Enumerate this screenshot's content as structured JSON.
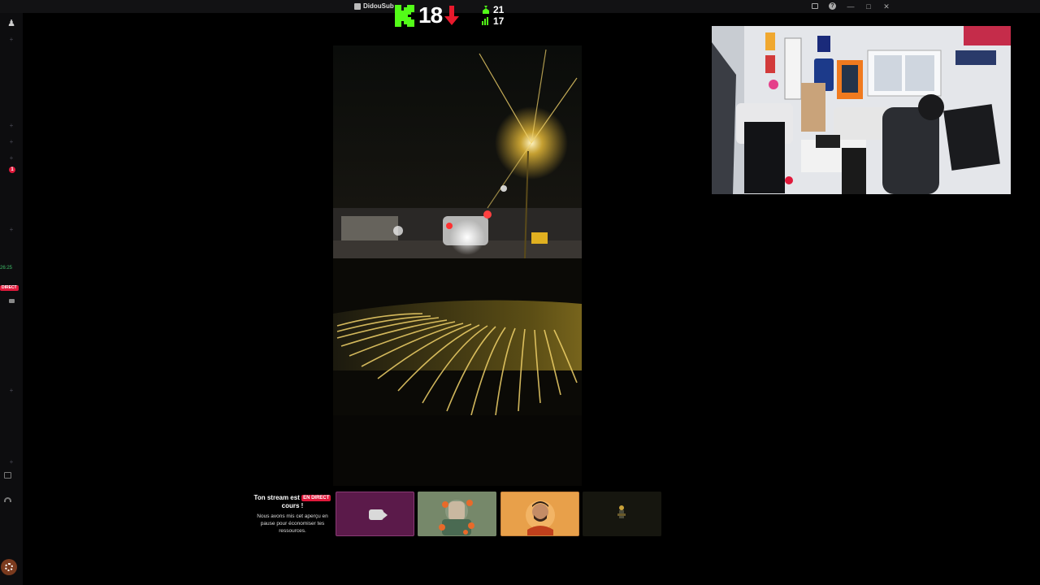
{
  "window": {
    "title": "DidouSub",
    "controls": [
      "inbox-icon",
      "help-icon",
      "minimize-icon",
      "maximize-icon",
      "close-icon"
    ]
  },
  "kick_overlay": {
    "rank": "18",
    "trend": "down",
    "stats": [
      {
        "icon": "person-icon",
        "value": "21"
      },
      {
        "icon": "bar-chart-icon",
        "value": "17"
      }
    ],
    "colors": {
      "kick_green": "#53fc18",
      "down_red": "#e8192c"
    }
  },
  "sidebar": {
    "time": "26:25",
    "live_badge": "DIRECT",
    "notification_count": "1"
  },
  "stream_notice": {
    "title_before": "Ton stream est",
    "live_badge": "EN DIRECT",
    "title_after": "cours !",
    "body": "Nous avons mis cet aperçu en pause pour économiser tes ressources."
  },
  "participants": [
    {
      "name": "screen-share-tile",
      "icon": "camera-icon",
      "color": "#5b1a4a"
    },
    {
      "name": "participant-avatar-2",
      "color": "#76886a"
    },
    {
      "name": "participant-avatar-3",
      "color": "#e8a04a"
    },
    {
      "name": "participant-avatar-4",
      "color": "#16160f"
    }
  ]
}
